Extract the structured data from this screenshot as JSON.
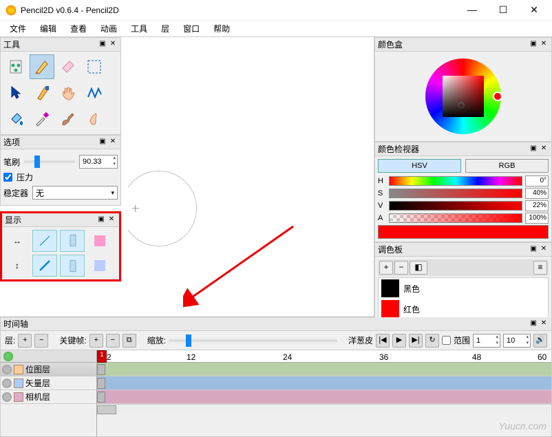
{
  "window": {
    "title": "Pencil2D v0.6.4 - Pencil2D"
  },
  "menu": {
    "items": [
      "文件",
      "编辑",
      "查看",
      "动画",
      "工具",
      "层",
      "窗口",
      "帮助"
    ]
  },
  "panels": {
    "tools": {
      "title": "工具"
    },
    "options": {
      "title": "选项",
      "brush_label": "笔刷",
      "brush_value": "90.33",
      "pressure_label": "压力",
      "pressure_checked": true,
      "stabilizer_label": "稳定器",
      "stabilizer_value": "无"
    },
    "display": {
      "title": "显示"
    },
    "colorbox": {
      "title": "颜色盒"
    },
    "colorinspect": {
      "title": "颜色检视器",
      "hsv": "HSV",
      "rgb": "RGB",
      "h": {
        "label": "H",
        "value": "0°"
      },
      "s": {
        "label": "S",
        "value": "40%"
      },
      "v": {
        "label": "V",
        "value": "22%"
      },
      "a": {
        "label": "A",
        "value": "100%"
      }
    },
    "palette": {
      "title": "调色板",
      "items": [
        {
          "name": "黑色",
          "color": "#000000"
        },
        {
          "name": "红色",
          "color": "#ff0000"
        }
      ]
    }
  },
  "timeline": {
    "title": "时间轴",
    "layers_label": "层:",
    "keyframes_label": "关键帧:",
    "zoom_label": "缩放:",
    "onion_label": "洋葱皮",
    "range_label": "范围",
    "range_start": "1",
    "range_end": "10",
    "ruler_marks": [
      "2",
      "12",
      "24",
      "36",
      "48",
      "60"
    ],
    "playhead": "1",
    "layers": [
      {
        "name": "位图层",
        "type": "bitmap"
      },
      {
        "name": "矢量层",
        "type": "vector"
      },
      {
        "name": "相机层",
        "type": "camera"
      }
    ]
  },
  "watermark": "Yuucn.com"
}
